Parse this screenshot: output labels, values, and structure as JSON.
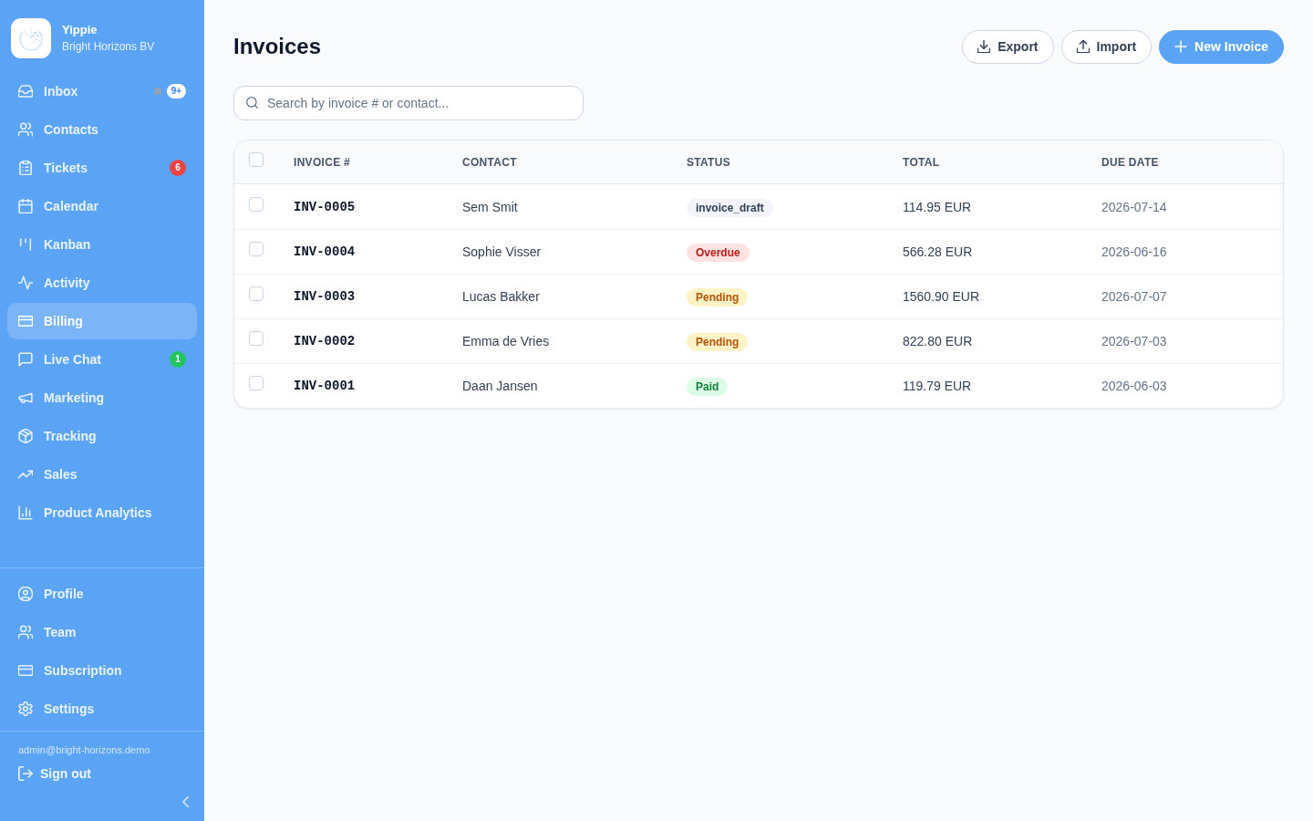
{
  "sidebar": {
    "brand": {
      "name": "Yippie",
      "subtitle": "Bright Horizons BV"
    },
    "nav": [
      {
        "label": "Inbox",
        "selected": false,
        "dot": true,
        "badge": {
          "text": "9+",
          "kind": "light"
        }
      },
      {
        "label": "Contacts",
        "selected": false,
        "dot": false
      },
      {
        "label": "Tickets",
        "selected": false,
        "dot": false,
        "badge": {
          "text": "6",
          "kind": "danger"
        }
      },
      {
        "label": "Calendar",
        "selected": false,
        "dot": false
      },
      {
        "label": "Kanban",
        "selected": false,
        "dot": false
      },
      {
        "label": "Activity",
        "selected": false,
        "dot": false
      },
      {
        "label": "Billing",
        "selected": true,
        "dot": false
      },
      {
        "label": "Live Chat",
        "selected": false,
        "dot": false,
        "badge": {
          "text": "1",
          "kind": "success"
        }
      },
      {
        "label": "Marketing",
        "selected": false,
        "dot": false
      },
      {
        "label": "Tracking",
        "selected": false,
        "dot": false
      },
      {
        "label": "Sales",
        "selected": false,
        "dot": false
      },
      {
        "label": "Product Analytics",
        "selected": false,
        "dot": false
      }
    ],
    "bottom_nav": [
      {
        "label": "Profile",
        "selected": false
      },
      {
        "label": "Team",
        "selected": false
      },
      {
        "label": "Subscription",
        "selected": false
      },
      {
        "label": "Settings",
        "selected": false
      }
    ],
    "footer": {
      "email": "admin@bright-horizons.demo",
      "sign_out": "Sign out"
    }
  },
  "page": {
    "title": "Invoices",
    "actions": [
      {
        "label": "Export",
        "kind": "outline"
      },
      {
        "label": "Import",
        "kind": "outline"
      },
      {
        "label": "New Invoice",
        "kind": "primary"
      }
    ]
  },
  "search": {
    "placeholder": "Search by invoice # or contact..."
  },
  "table": {
    "select_all_checked": false,
    "columns": [
      "INVOICE #",
      "CONTACT",
      "STATUS",
      "TOTAL",
      "DUE DATE"
    ],
    "rows": [
      {
        "checked": false,
        "invoice": "INV-0005",
        "contact": "Sem Smit",
        "status": {
          "label": "invoice_draft",
          "kind": "draft"
        },
        "total": "114.95 EUR",
        "due_date": "2026-07-14"
      },
      {
        "checked": false,
        "invoice": "INV-0004",
        "contact": "Sophie Visser",
        "status": {
          "label": "Overdue",
          "kind": "overdue"
        },
        "total": "566.28 EUR",
        "due_date": "2026-06-16"
      },
      {
        "checked": false,
        "invoice": "INV-0003",
        "contact": "Lucas Bakker",
        "status": {
          "label": "Pending",
          "kind": "pending"
        },
        "total": "1560.90 EUR",
        "due_date": "2026-07-07"
      },
      {
        "checked": false,
        "invoice": "INV-0002",
        "contact": "Emma de Vries",
        "status": {
          "label": "Pending",
          "kind": "pending"
        },
        "total": "822.80 EUR",
        "due_date": "2026-07-03"
      },
      {
        "checked": false,
        "invoice": "INV-0001",
        "contact": "Daan Jansen",
        "status": {
          "label": "Paid",
          "kind": "paid"
        },
        "total": "119.79 EUR",
        "due_date": "2026-06-03"
      }
    ]
  }
}
